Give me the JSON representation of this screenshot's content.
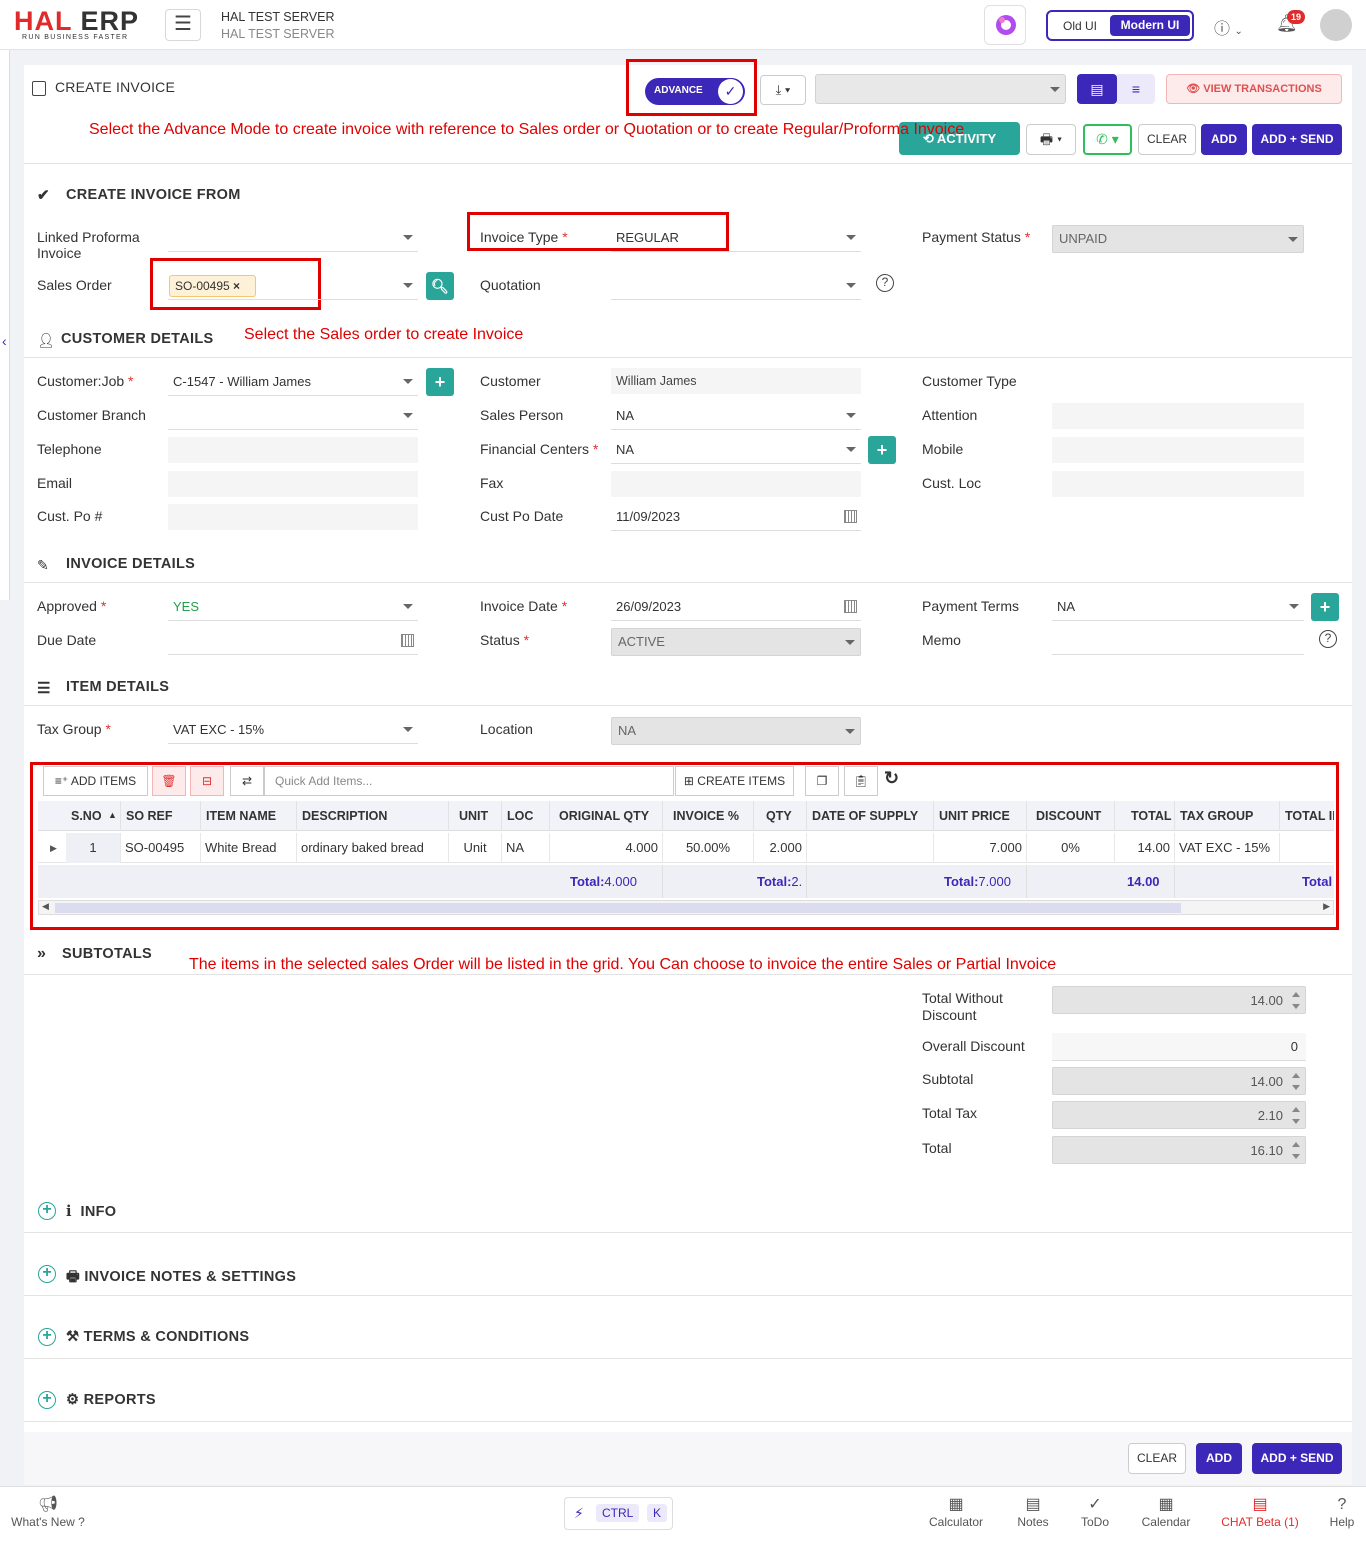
{
  "app": {
    "logo_main": "HAL",
    "logo_second": "ERP",
    "logo_tagline": "RUN BUSINESS FASTER",
    "server_name": "HAL TEST SERVER",
    "server_sub": "HAL TEST SERVER",
    "old_ui": "Old UI",
    "modern_ui": "Modern UI",
    "notif_count": "19"
  },
  "page": {
    "title": "CREATE INVOICE",
    "advance_label": "ADVANCE",
    "view_transactions": "VIEW TRANSACTIONS",
    "activity": "ACTIVITY",
    "clear": "CLEAR",
    "add": "ADD",
    "add_send": "ADD + SEND"
  },
  "annotations": {
    "advance_note": "Select the Advance Mode to create invoice with reference to Sales order or Quotation or to create Regular/Proforma Invoice",
    "sales_order_note": "Select the Sales order to create Invoice",
    "grid_note": "The items in the selected sales Order will be listed in the grid. You Can choose to invoice the entire Sales or Partial Invoice"
  },
  "create_from": {
    "heading": "CREATE INVOICE FROM",
    "linked_proforma_label": "Linked Proforma Invoice",
    "linked_proforma_value": "",
    "invoice_type_label": "Invoice Type",
    "invoice_type_value": "REGULAR",
    "payment_status_label": "Payment Status",
    "payment_status_value": "UNPAID",
    "sales_order_label": "Sales Order",
    "sales_order_chip": "SO-00495",
    "quotation_label": "Quotation",
    "quotation_value": ""
  },
  "customer": {
    "heading": "CUSTOMER DETAILS",
    "customer_job_label": "Customer:Job",
    "customer_job_value": "C-1547 - William James",
    "customer_label": "Customer",
    "customer_value": "William James",
    "customer_type_label": "Customer Type",
    "branch_label": "Customer Branch",
    "sales_person_label": "Sales Person",
    "sales_person_value": "NA",
    "attention_label": "Attention",
    "telephone_label": "Telephone",
    "financial_centers_label": "Financial Centers",
    "financial_centers_value": "NA",
    "mobile_label": "Mobile",
    "email_label": "Email",
    "fax_label": "Fax",
    "cust_loc_label": "Cust. Loc",
    "cust_po_label": "Cust. Po #",
    "cust_po_date_label": "Cust Po Date",
    "cust_po_date_value": "11/09/2023"
  },
  "invoice": {
    "heading": "INVOICE DETAILS",
    "approved_label": "Approved",
    "approved_value": "YES",
    "invoice_date_label": "Invoice Date",
    "invoice_date_value": "26/09/2023",
    "payment_terms_label": "Payment Terms",
    "payment_terms_value": "NA",
    "due_date_label": "Due Date",
    "status_label": "Status",
    "status_value": "ACTIVE",
    "memo_label": "Memo"
  },
  "items": {
    "heading": "ITEM DETAILS",
    "tax_group_label": "Tax Group",
    "tax_group_value": "VAT EXC - 15%",
    "location_label": "Location",
    "location_value": "NA",
    "add_items": "ADD ITEMS",
    "quick_add_placeholder": "Quick Add Items...",
    "create_items": "CREATE ITEMS",
    "columns": [
      "S.NO",
      "SO REF",
      "ITEM NAME",
      "DESCRIPTION",
      "UNIT",
      "LOC",
      "ORIGINAL QTY",
      "INVOICE %",
      "QTY",
      "DATE OF SUPPLY",
      "UNIT PRICE",
      "DISCOUNT",
      "TOTAL",
      "TAX GROUP",
      "TOTAL IN"
    ],
    "rows": [
      {
        "sno": "1",
        "so_ref": "SO-00495",
        "item_name": "White Bread",
        "description": "ordinary baked bread",
        "unit": "Unit",
        "loc": "NA",
        "original_qty": "4.000",
        "invoice_pct": "50.00%",
        "qty": "2.000",
        "date_of_supply": "",
        "unit_price": "7.000",
        "discount": "0%",
        "total": "14.00",
        "tax_group": "VAT EXC - 15%"
      }
    ],
    "totals": {
      "label": "Total:",
      "original_qty": "4.000",
      "qty": "2.",
      "unit_price": "7.000",
      "total": "14.00",
      "total_in": "Total"
    }
  },
  "subtotals": {
    "heading": "SUBTOTALS",
    "total_without_discount_label": "Total Without Discount",
    "total_without_discount": "14.00",
    "overall_discount_label": "Overall Discount",
    "overall_discount": "0",
    "subtotal_label": "Subtotal",
    "subtotal": "14.00",
    "total_tax_label": "Total Tax",
    "total_tax": "2.10",
    "total_label": "Total",
    "total": "16.10"
  },
  "collapsibles": {
    "info": "INFO",
    "notes": "INVOICE NOTES & SETTINGS",
    "terms": "TERMS & CONDITIONS",
    "reports": "REPORTS"
  },
  "footer": {
    "whats_new": "What's New ?",
    "ctrl": "CTRL",
    "k": "K",
    "calculator": "Calculator",
    "notes": "Notes",
    "todo": "ToDo",
    "calendar": "Calendar",
    "chat": "CHAT Beta (1)",
    "help": "Help"
  },
  "colors": {
    "brand": "#3b27b8",
    "accent_red": "#e02b2b",
    "teal": "#2aa59a",
    "annotation_red": "#e00000"
  }
}
